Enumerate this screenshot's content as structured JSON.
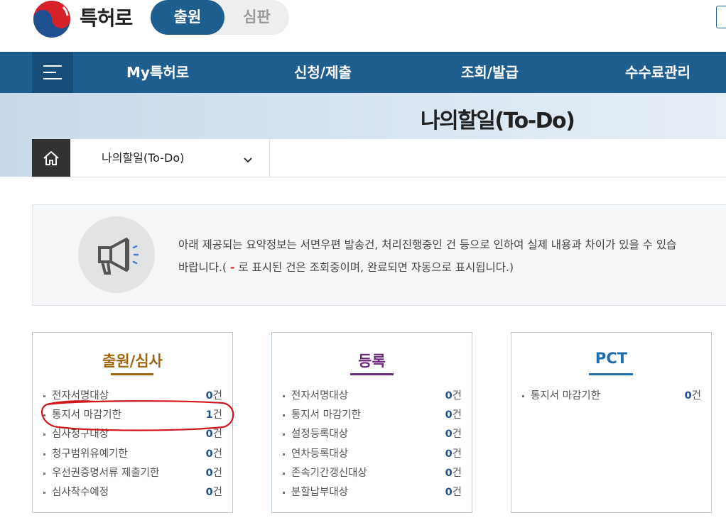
{
  "header": {
    "site_name": "특허로",
    "toggle_active": "출원",
    "toggle_inactive": "심판"
  },
  "nav": {
    "items": [
      "My특허로",
      "신청/제출",
      "조회/발급",
      "수수료관리"
    ]
  },
  "banner": {
    "title": "나의할일(To-Do)",
    "breadcrumb": "나의할일(To-Do)"
  },
  "notice": {
    "line1": "아래 제공되는 요약정보는 서면우편 발송건, 처리진행중인 건 등으로 인하여 실제 내용과 차이가 있을 수 있습",
    "line2_before": "바랍니다.( ",
    "line2_dash": "-",
    "line2_after": " 로 표시된 건은 조회중이며, 완료되면 자동으로 표시됩니다.)"
  },
  "unit": "건",
  "cards": [
    {
      "title": "출원/심사",
      "color": "#a0660f",
      "items": [
        {
          "label": "전자서명대상",
          "count": "0"
        },
        {
          "label": "통지서 마감기한",
          "count": "1"
        },
        {
          "label": "심사청구대상",
          "count": "0"
        },
        {
          "label": "청구범위유예기한",
          "count": "0"
        },
        {
          "label": "우선권증명서류 제출기한",
          "count": "0"
        },
        {
          "label": "심사착수예정",
          "count": "0"
        }
      ]
    },
    {
      "title": "등록",
      "color": "#6b2a7a",
      "items": [
        {
          "label": "전자서명대상",
          "count": "0"
        },
        {
          "label": "통지서 마감기한",
          "count": "0"
        },
        {
          "label": "설정등록대상",
          "count": "0"
        },
        {
          "label": "연차등록대상",
          "count": "0"
        },
        {
          "label": "존속기간갱신대상",
          "count": "0"
        },
        {
          "label": "분할납부대상",
          "count": "0"
        }
      ]
    },
    {
      "title": "PCT",
      "color": "#1f6fae",
      "items": [
        {
          "label": "통지서 마감기한",
          "count": "0"
        }
      ]
    }
  ],
  "colors": {
    "nav_bg": "#1f5f8f",
    "accent_red": "#e1261c",
    "count_blue": "#1f4f8f"
  }
}
